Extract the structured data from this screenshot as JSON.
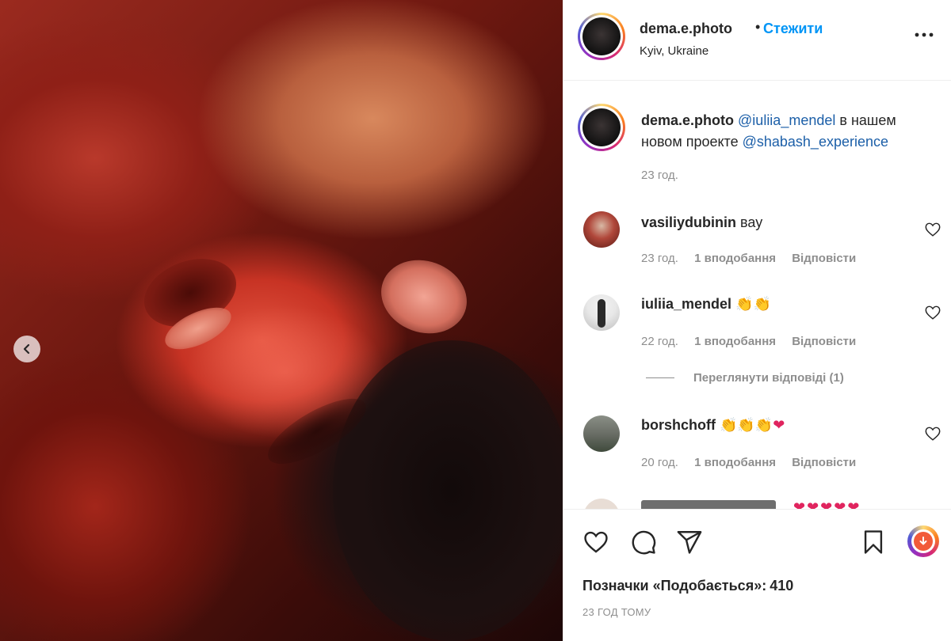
{
  "post": {
    "author": "dema.e.photo",
    "follow_label": "Стежити",
    "location": "Kyiv, Ukraine",
    "dot": "•"
  },
  "caption": {
    "username": "dema.e.photo",
    "mention1": "@iuliia_mendel",
    "text1": " в нашем новом проекте ",
    "mention2": "@shabash_experience",
    "time": "23 год."
  },
  "comments": [
    {
      "username": "vasiliydubinin",
      "text": "вау",
      "time": "23 год.",
      "likes": "1 вподобання",
      "reply": "Відповісти"
    },
    {
      "username": "iuliia_mendel",
      "text": "👏👏",
      "time": "22 год.",
      "likes": "1 вподобання",
      "reply": "Відповісти"
    },
    {
      "username": "borshchoff",
      "text": "👏👏👏",
      "text_heart": "❤",
      "time": "20 год.",
      "likes": "1 вподобання",
      "reply": "Відповісти"
    }
  ],
  "view_replies": "Переглянути відповіді (1)",
  "partial_comment_hearts": "❤❤❤❤❤",
  "likes_label": "Позначки «Подобається»:",
  "likes_count": "410",
  "post_time": "23 ГОД ТОМУ",
  "icons": {
    "like": "heart-icon",
    "comment": "comment-icon",
    "share": "share-icon",
    "save": "bookmark-icon",
    "more": "more-horizontal-icon",
    "prev": "chevron-left-icon"
  },
  "colors": {
    "follow": "#0095f6",
    "mention": "#1c5fa8",
    "muted": "#8e8e8e",
    "text": "#262626",
    "heart": "#e0245e"
  }
}
